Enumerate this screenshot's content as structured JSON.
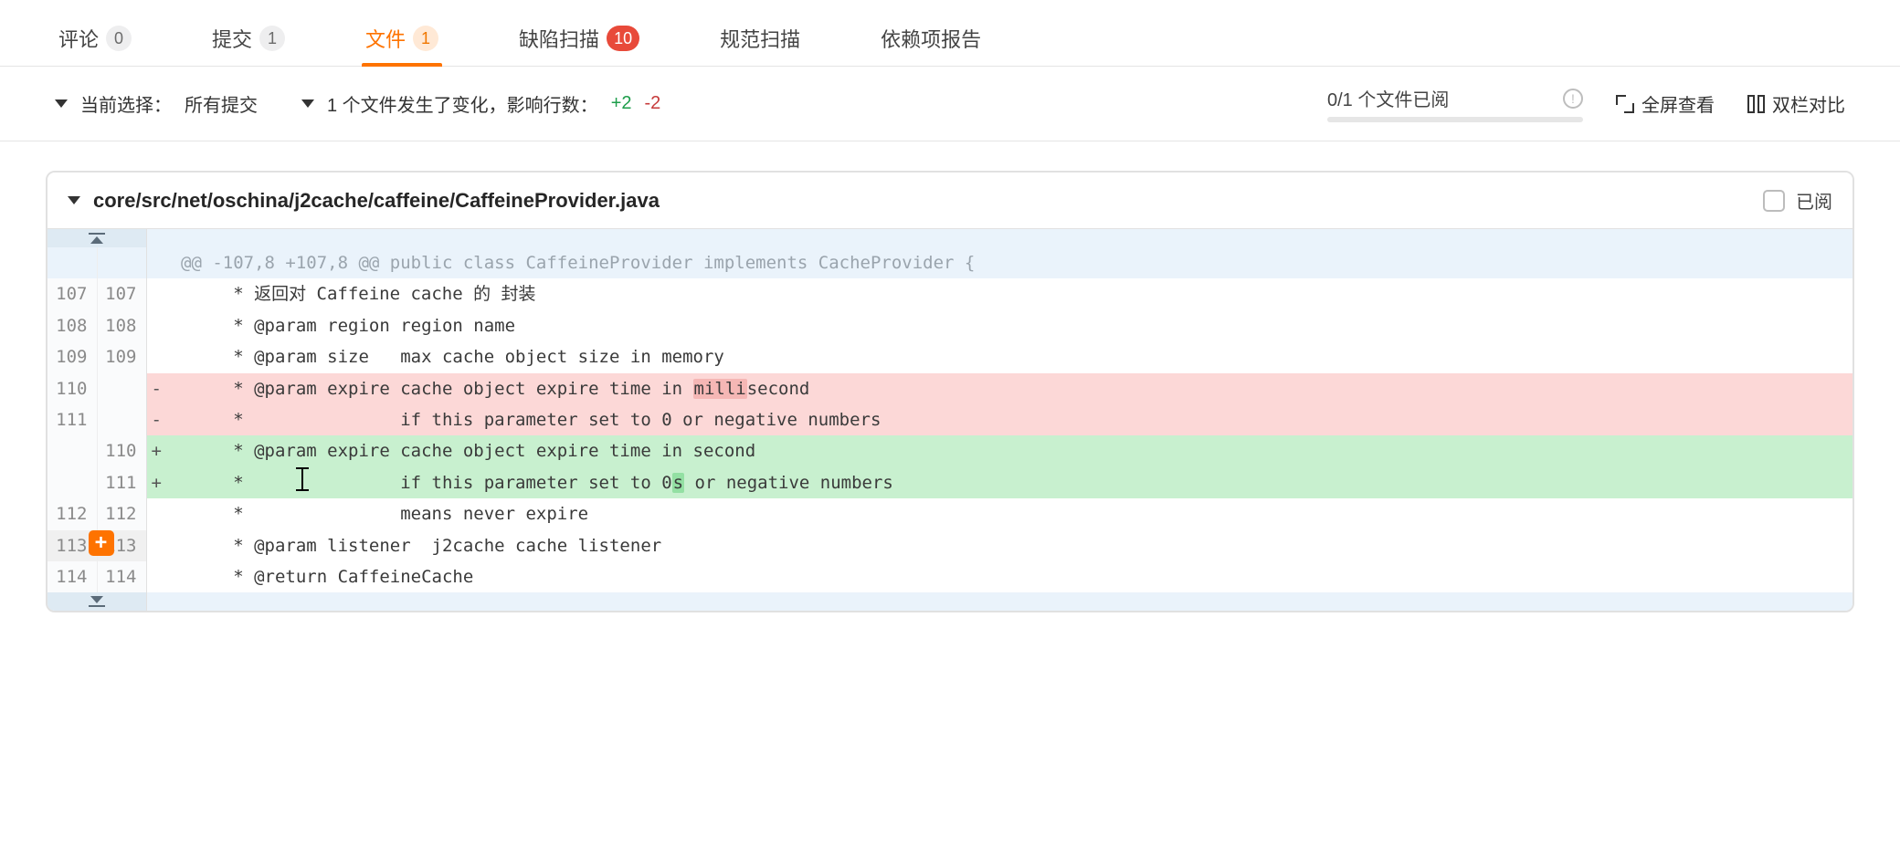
{
  "tabs": {
    "comments": {
      "label": "评论",
      "count": "0"
    },
    "commits": {
      "label": "提交",
      "count": "1"
    },
    "files": {
      "label": "文件",
      "count": "1"
    },
    "defects": {
      "label": "缺陷扫描",
      "count": "10"
    },
    "lint": {
      "label": "规范扫描"
    },
    "deps": {
      "label": "依赖项报告"
    }
  },
  "toolbar": {
    "current_label": "当前选择：",
    "current_value": "所有提交",
    "change_summary": "1 个文件发生了变化，影响行数：",
    "add": "+2",
    "del": "-2",
    "progress": "0/1 个文件已阅",
    "fullscreen": "全屏查看",
    "split": "双栏对比"
  },
  "file": {
    "path": "core/src/net/oschina/j2cache/caffeine/CaffeineProvider.java",
    "read_label": "已阅"
  },
  "hunk": "@@ -107,8 +107,8 @@ public class CaffeineProvider implements CacheProvider {",
  "lines": [
    {
      "ol": "107",
      "nl": "107",
      "t": "ctx",
      "code": "     * 返回对 Caffeine cache 的 封装"
    },
    {
      "ol": "108",
      "nl": "108",
      "t": "ctx",
      "code": "     * @param region region name"
    },
    {
      "ol": "109",
      "nl": "109",
      "t": "ctx",
      "code": "     * @param size   max cache object size in memory"
    },
    {
      "ol": "110",
      "nl": "",
      "t": "del",
      "code_pre": "     * @param expire cache object expire time in ",
      "code_hl": "milli",
      "code_post": "second"
    },
    {
      "ol": "111",
      "nl": "",
      "t": "del",
      "code": "     *               if this parameter set to 0 or negative numbers"
    },
    {
      "ol": "",
      "nl": "110",
      "t": "add",
      "code": "     * @param expire cache object expire time in second"
    },
    {
      "ol": "",
      "nl": "111",
      "t": "add",
      "code_pre": "     *               if this parameter set to 0",
      "code_hl": "s",
      "code_post": " or negative numbers"
    },
    {
      "ol": "112",
      "nl": "112",
      "t": "ctx",
      "code": "     *               means never expire"
    },
    {
      "ol": "113",
      "nl": "113",
      "t": "ctx",
      "code": "     * @param listener  j2cache cache listener",
      "hovered": true,
      "addbtn": true
    },
    {
      "ol": "114",
      "nl": "114",
      "t": "ctx",
      "code": "     * @return CaffeineCache"
    }
  ]
}
